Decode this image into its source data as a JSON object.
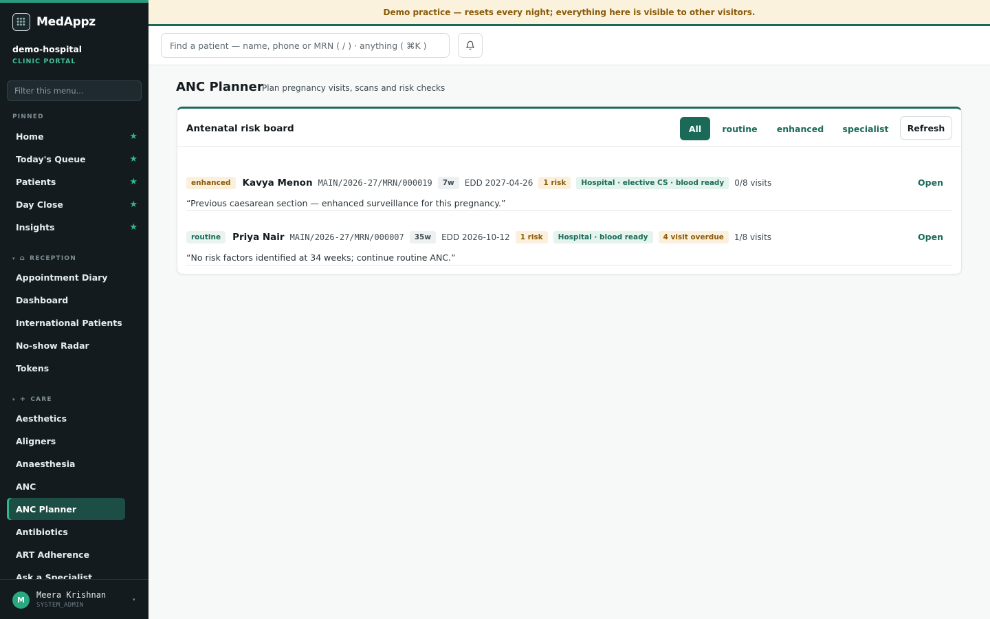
{
  "app": {
    "name": "MedAppz"
  },
  "org": {
    "name": "demo-hospital",
    "portal": "CLINIC PORTAL"
  },
  "banner": {
    "text": "Demo practice — resets every night; everything here is visible to other visitors."
  },
  "sidebar": {
    "filter_placeholder": "Filter this menu...",
    "pinned_label": "PINNED",
    "pinned": [
      {
        "label": "Home"
      },
      {
        "label": "Today's Queue"
      },
      {
        "label": "Patients"
      },
      {
        "label": "Day Close"
      },
      {
        "label": "Insights"
      }
    ],
    "reception_label": "RECEPTION",
    "reception": [
      {
        "label": "Appointment Diary"
      },
      {
        "label": "Dashboard"
      },
      {
        "label": "International Patients"
      },
      {
        "label": "No-show Radar"
      },
      {
        "label": "Tokens"
      }
    ],
    "care_label": "CARE",
    "care": [
      {
        "label": "Aesthetics"
      },
      {
        "label": "Aligners"
      },
      {
        "label": "Anaesthesia"
      },
      {
        "label": "ANC"
      },
      {
        "label": "ANC Planner"
      },
      {
        "label": "Antibiotics"
      },
      {
        "label": "ART Adherence"
      },
      {
        "label": "Ask a Specialist"
      }
    ],
    "active_item": "ANC Planner"
  },
  "user": {
    "initial": "M",
    "name": "Meera Krishnan",
    "role": "SYSTEM_ADMIN"
  },
  "search": {
    "placeholder": "Find a patient — name, phone or MRN ( / ) · anything ( ⌘K )"
  },
  "page": {
    "title": "ANC Planner",
    "subtitle": "Plan pregnancy visits, scans and risk checks"
  },
  "board": {
    "title": "Antenatal risk board",
    "filters": [
      "All",
      "routine",
      "enhanced",
      "specialist"
    ],
    "active_filter": "All",
    "refresh_label": "Refresh",
    "rows": [
      {
        "level": "enhanced",
        "name": "Kavya Menon",
        "mrn": "MAIN/2026-27/MRN/000019",
        "weeks": "7w",
        "edd": "EDD 2027-04-26",
        "risk": "1 risk",
        "plan": "Hospital · elective CS · blood ready",
        "overdue": "",
        "visits": "0/8 visits",
        "note": "“Previous caesarean section — enhanced surveillance for this pregnancy.”",
        "action": "Open"
      },
      {
        "level": "routine",
        "name": "Priya Nair",
        "mrn": "MAIN/2026-27/MRN/000007",
        "weeks": "35w",
        "edd": "EDD 2026-10-12",
        "risk": "1 risk",
        "plan": "Hospital · blood ready",
        "overdue": "4 visit overdue",
        "visits": "1/8 visits",
        "note": "“No risk factors identified at 34 weeks; continue routine ANC.”",
        "action": "Open"
      }
    ]
  },
  "colors": {
    "accent": "#1b6a58",
    "sidebar_bg": "#131b1f",
    "pin_star": "#2fb88d",
    "warning_text": "#8a5a08",
    "banner_bg": "#fbf2dd"
  },
  "icons": {
    "pin": "star-icon",
    "notifications": "bell-icon",
    "reception": "building-icon",
    "care": "plus-icon"
  }
}
